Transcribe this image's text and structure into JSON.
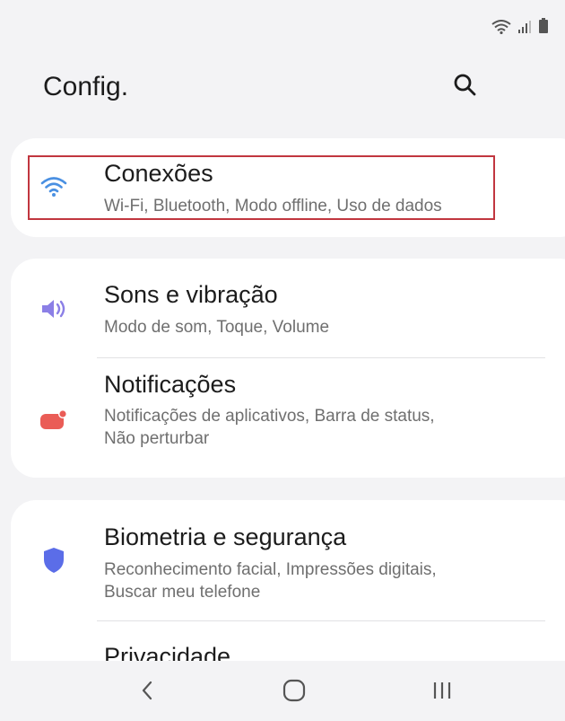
{
  "header": {
    "title": "Config."
  },
  "status_icons": [
    "wifi-icon",
    "signal-icon",
    "battery-icon"
  ],
  "sections": [
    {
      "items": [
        {
          "title": "Conexões",
          "subtitle": "Wi-Fi, Bluetooth, Modo offline, Uso de dados",
          "icon": "wifi-icon",
          "icon_color": "#4a90e2"
        }
      ]
    },
    {
      "items": [
        {
          "title": "Sons e vibração",
          "subtitle": "Modo de som, Toque, Volume",
          "icon": "volume-icon",
          "icon_color": "#8b7fe6"
        },
        {
          "title": "Notificações",
          "subtitle_line1": "Notificações de aplicativos, Barra de status,",
          "subtitle_line2": "Não perturbar",
          "icon": "notification-icon",
          "icon_color": "#ea5c56"
        }
      ]
    },
    {
      "items": [
        {
          "title": "Biometria e segurança",
          "subtitle_line1": "Reconhecimento facial, Impressões digitais,",
          "subtitle_line2": "Buscar meu telefone",
          "icon": "shield-icon",
          "icon_color": "#5b6de8"
        },
        {
          "title": "Privacidade",
          "icon": "privacy-icon",
          "icon_color": "#5b8de8"
        }
      ]
    }
  ],
  "highlight_color": "#c1363f",
  "navbar": [
    "back-icon",
    "home-icon",
    "recents-icon"
  ]
}
